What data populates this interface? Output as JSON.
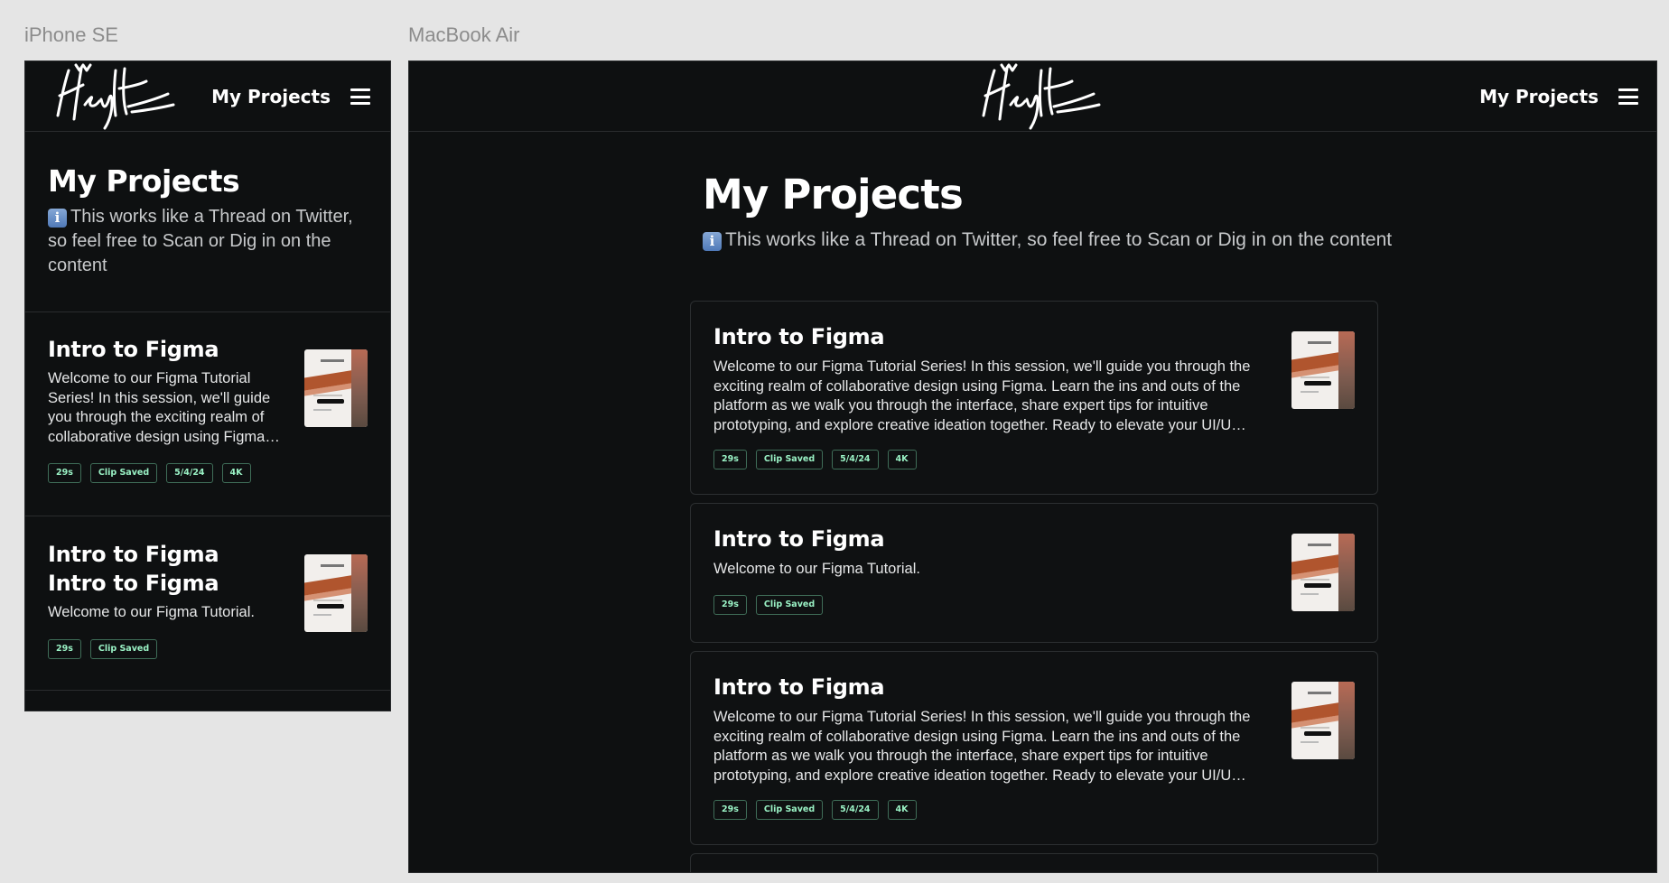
{
  "frames": {
    "phone_label": "iPhone SE",
    "mac_label": "MacBook Air"
  },
  "nav": {
    "label": "My Projects",
    "logo_icon": "signature-logo-icon",
    "menu_icon": "hamburger-menu-icon"
  },
  "page": {
    "title": "My Projects",
    "info_icon": "information-icon",
    "subtitle": "This works like a Thread on Twitter, so feel free to Scan or Dig in on the content"
  },
  "phone_cards": [
    {
      "title": "Intro to Figma",
      "description": "Welcome to our Figma Tutorial Series! In this session, we'll guide you through the exciting realm of collaborative design using Figma. Learn the ins and outs of the platform as we walk you through the interface, share expert tips for intuitive prototyping, and explore creative ideation together. Ready to elevate your UI/UX skills?",
      "tags": [
        "29s",
        "Clip Saved",
        "5/4/24",
        "4K"
      ]
    },
    {
      "title": "Intro to Figma Intro to Figma",
      "description": "Welcome to our Figma Tutorial.",
      "tags": [
        "29s",
        "Clip Saved"
      ]
    }
  ],
  "mac_cards": [
    {
      "title": "Intro to Figma",
      "description": "Welcome to our Figma Tutorial Series! In this session, we'll guide you through the exciting realm of collaborative design using Figma. Learn the ins and outs of the platform as we walk you through the interface, share expert tips for intuitive prototyping, and explore creative ideation together. Ready to elevate your UI/UX skills?",
      "tags": [
        "29s",
        "Clip Saved",
        "5/4/24",
        "4K"
      ]
    },
    {
      "title": "Intro to Figma",
      "description": "Welcome to our Figma Tutorial.",
      "tags": [
        "29s",
        "Clip Saved"
      ]
    },
    {
      "title": "Intro to Figma",
      "description": "Welcome to our Figma Tutorial Series! In this session, we'll guide you through the exciting realm of collaborative design using Figma. Learn the ins and outs of the platform as we walk you through the interface, share expert tips for intuitive prototyping, and explore creative ideation together. Ready to elevate your UI/UX skills?",
      "tags": [
        "29s",
        "Clip Saved",
        "5/4/24",
        "4K"
      ]
    }
  ],
  "colors": {
    "background": "#0e1011",
    "canvas": "#e5e5e5",
    "tag_text": "#9af2c5",
    "tag_border": "#3f6d58"
  }
}
